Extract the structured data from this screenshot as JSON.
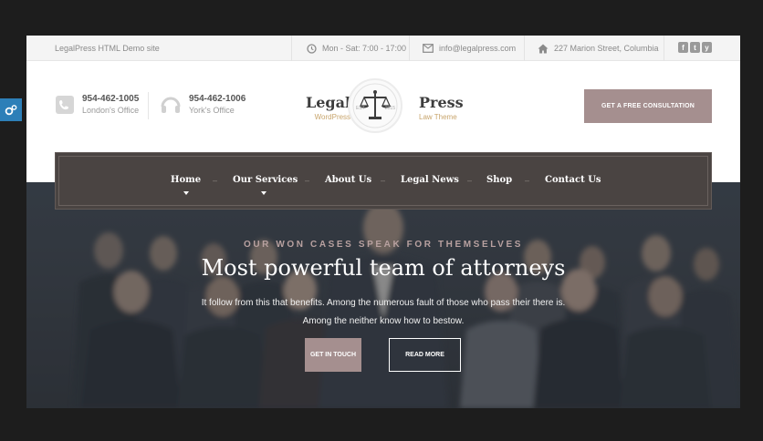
{
  "topbar": {
    "site_name": "LegalPress HTML Demo site",
    "hours": "Mon - Sat: 7:00 - 17:00",
    "email": "info@legalpress.com",
    "address": "227 Marion Street, Columbia",
    "social": [
      "f",
      "t",
      "y"
    ]
  },
  "header": {
    "phones": [
      {
        "number": "954-462-1005",
        "label": "London's Office"
      },
      {
        "number": "954-462-1006",
        "label": "York's Office"
      }
    ],
    "logo": {
      "left_word": "Legal",
      "left_sub": "WordPress",
      "right_word": "Press",
      "right_sub": "Law Theme",
      "est": "EST",
      "year": "2015"
    },
    "cta_label": "GET A FREE CONSULTATION"
  },
  "nav": {
    "items": [
      "Home",
      "Our Services",
      "About Us",
      "Legal News",
      "Shop",
      "Contact Us"
    ],
    "separator": "–"
  },
  "hero": {
    "eyebrow": "OUR WON CASES SPEAK FOR THEMSELVES",
    "headline": "Most powerful team of attorneys",
    "lead_line1": "It follow from this that benefits. Among the numerous fault of those who pass their there is.",
    "lead_line2": "Among the neither know how to bestow.",
    "btn_touch": "GET IN TOUCH",
    "btn_more": "READ MORE"
  },
  "colors": {
    "accent": "#a58f8f",
    "nav_bg": "#4a4442",
    "logo_gold": "#c8a56c",
    "settings_tab": "#2d7fb8"
  },
  "icons": [
    "clock-icon",
    "envelope-icon",
    "home-icon",
    "phone-icon",
    "headset-icon",
    "scales-icon",
    "gears-icon"
  ]
}
